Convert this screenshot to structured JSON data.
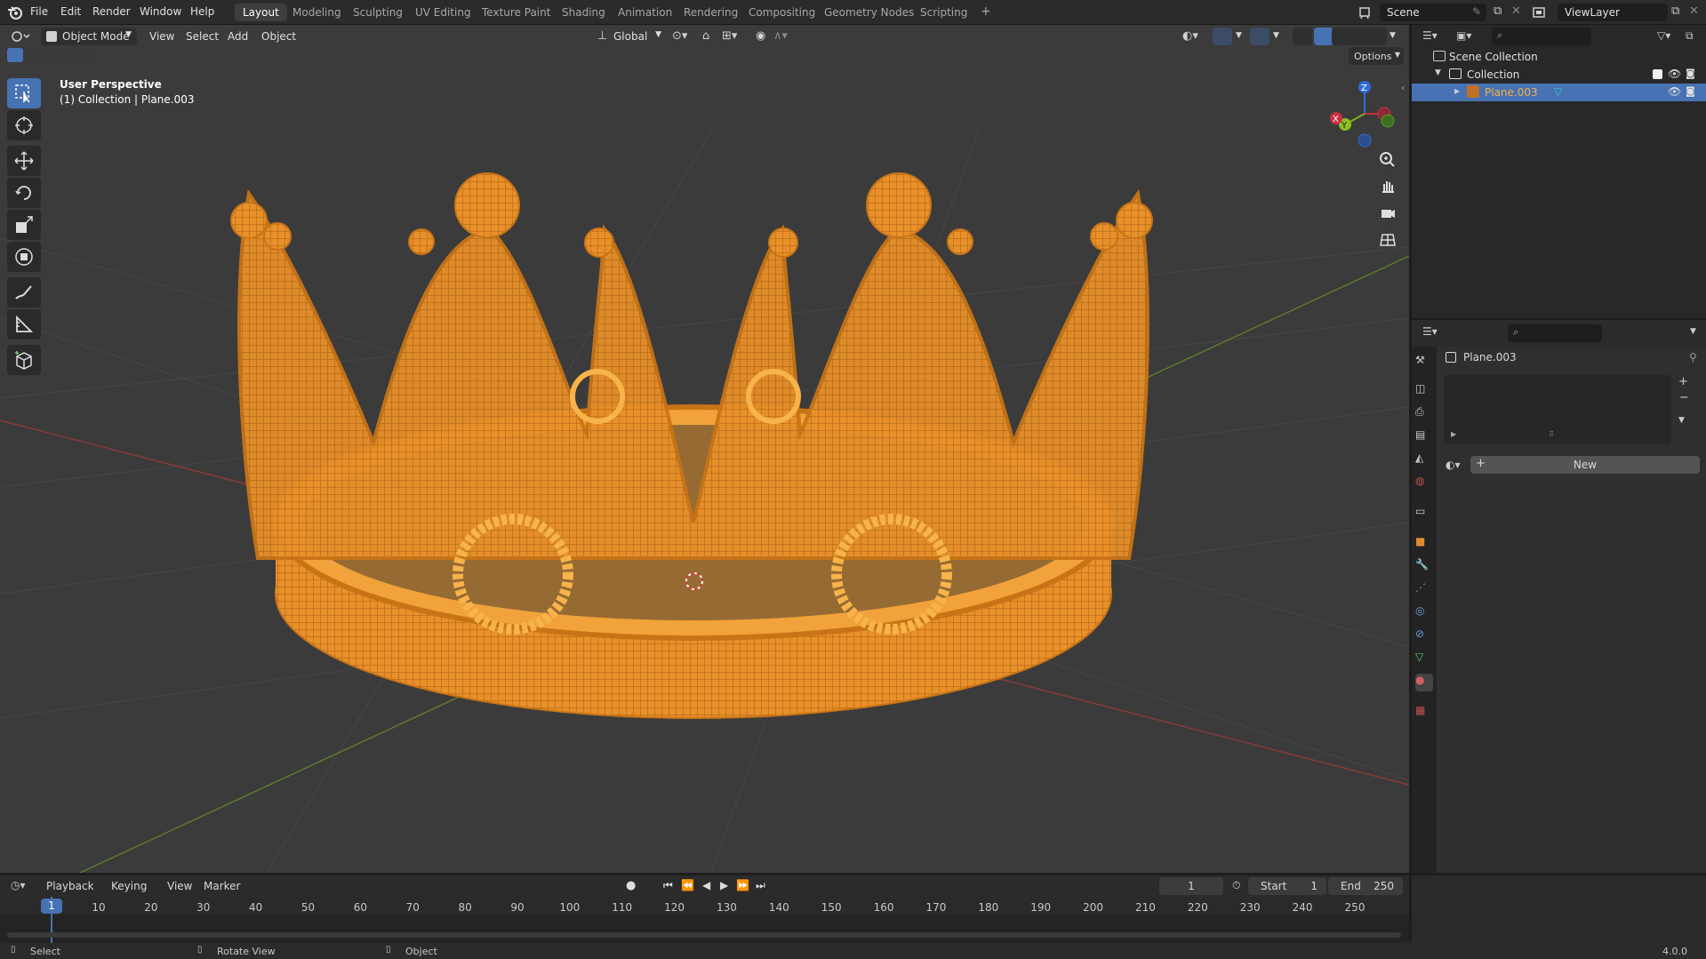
{
  "app": {
    "menu": [
      "File",
      "Edit",
      "Render",
      "Window",
      "Help"
    ],
    "workspaces": [
      "Layout",
      "Modeling",
      "Sculpting",
      "UV Editing",
      "Texture Paint",
      "Shading",
      "Animation",
      "Rendering",
      "Compositing",
      "Geometry Nodes",
      "Scripting"
    ],
    "active_workspace": "Layout",
    "add_tab": "+",
    "scene": "Scene",
    "view_layer": "ViewLayer",
    "version": "4.0.0"
  },
  "viewport": {
    "mode": "Object Mode",
    "menus": [
      "View",
      "Select",
      "Add",
      "Object"
    ],
    "transform_orientation": "Global",
    "options_label": "Options",
    "overlay_title": "User Perspective",
    "overlay_subtitle": "(1) Collection | Plane.003",
    "gizmo_axes": [
      "X",
      "Y",
      "Z"
    ],
    "crown_color": "#f2a23a",
    "background_color": "#3b3b3b"
  },
  "outliner": {
    "rows": [
      {
        "label": "Scene Collection"
      },
      {
        "label": "Collection"
      },
      {
        "label": "Plane.003"
      }
    ]
  },
  "properties": {
    "object_name": "Plane.003",
    "new_button": "New"
  },
  "timeline": {
    "menus": [
      "Playback",
      "Keying",
      "View",
      "Marker"
    ],
    "current_frame": "1",
    "start_label": "Start",
    "start_value": "1",
    "end_label": "End",
    "end_value": "250",
    "ticks": [
      "1",
      "10",
      "20",
      "30",
      "40",
      "50",
      "60",
      "70",
      "80",
      "90",
      "100",
      "110",
      "120",
      "130",
      "140",
      "150",
      "160",
      "170",
      "180",
      "190",
      "200",
      "210",
      "220",
      "230",
      "240",
      "250"
    ]
  },
  "status": {
    "select": "Select",
    "rotate": "Rotate View",
    "object": "Object"
  }
}
